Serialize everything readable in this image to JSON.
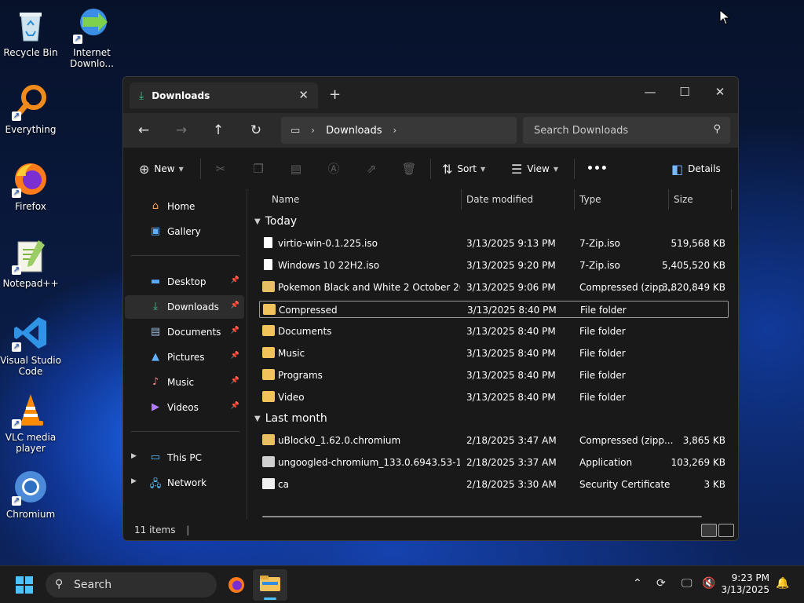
{
  "desktop": {
    "icons": [
      {
        "label": "Recycle Bin"
      },
      {
        "label": "Internet Downlo..."
      },
      {
        "label": "Everything"
      },
      {
        "label": "Firefox"
      },
      {
        "label": "Notepad++"
      },
      {
        "label": "Visual Studio Code"
      },
      {
        "label": "VLC media player"
      },
      {
        "label": "Chromium"
      }
    ]
  },
  "window": {
    "tab_title": "Downloads",
    "address": {
      "segment": "Downloads"
    },
    "search_placeholder": "Search Downloads",
    "toolbar": {
      "new": "New",
      "sort": "Sort",
      "view": "View",
      "more": "•••",
      "details": "Details"
    },
    "nav": {
      "items": [
        {
          "label": "Home"
        },
        {
          "label": "Gallery"
        },
        {
          "label": "Desktop"
        },
        {
          "label": "Downloads"
        },
        {
          "label": "Documents"
        },
        {
          "label": "Pictures"
        },
        {
          "label": "Music"
        },
        {
          "label": "Videos"
        },
        {
          "label": "This PC"
        },
        {
          "label": "Network"
        }
      ]
    },
    "columns": {
      "name": "Name",
      "date": "Date modified",
      "type": "Type",
      "size": "Size"
    },
    "groups": [
      {
        "label": "Today",
        "rows": [
          {
            "name": "virtio-win-0.1.225.iso",
            "date": "3/13/2025 9:13 PM",
            "type": "7-Zip.iso",
            "size": "519,568 KB"
          },
          {
            "name": "Windows 10 22H2.iso",
            "date": "3/13/2025 9:20 PM",
            "type": "7-Zip.iso",
            "size": "5,405,520 KB"
          },
          {
            "name": "Pokemon Black and White 2 October 201...",
            "date": "3/13/2025 9:06 PM",
            "type": "Compressed (zipp...",
            "size": "3,820,849 KB"
          },
          {
            "name": "Compressed",
            "date": "3/13/2025 8:40 PM",
            "type": "File folder",
            "size": ""
          },
          {
            "name": "Documents",
            "date": "3/13/2025 8:40 PM",
            "type": "File folder",
            "size": ""
          },
          {
            "name": "Music",
            "date": "3/13/2025 8:40 PM",
            "type": "File folder",
            "size": ""
          },
          {
            "name": "Programs",
            "date": "3/13/2025 8:40 PM",
            "type": "File folder",
            "size": ""
          },
          {
            "name": "Video",
            "date": "3/13/2025 8:40 PM",
            "type": "File folder",
            "size": ""
          }
        ]
      },
      {
        "label": "Last month",
        "rows": [
          {
            "name": "uBlock0_1.62.0.chromium",
            "date": "2/18/2025 3:47 AM",
            "type": "Compressed (zipp...",
            "size": "3,865 KB"
          },
          {
            "name": "ungoogled-chromium_133.0.6943.53-1.1...",
            "date": "2/18/2025 3:37 AM",
            "type": "Application",
            "size": "103,269 KB"
          },
          {
            "name": "ca",
            "date": "2/18/2025 3:30 AM",
            "type": "Security Certificate",
            "size": "3 KB"
          }
        ]
      }
    ],
    "status": "11 items"
  },
  "taskbar": {
    "search_label": "Search",
    "time": "9:23 PM",
    "date": "3/13/2025"
  }
}
